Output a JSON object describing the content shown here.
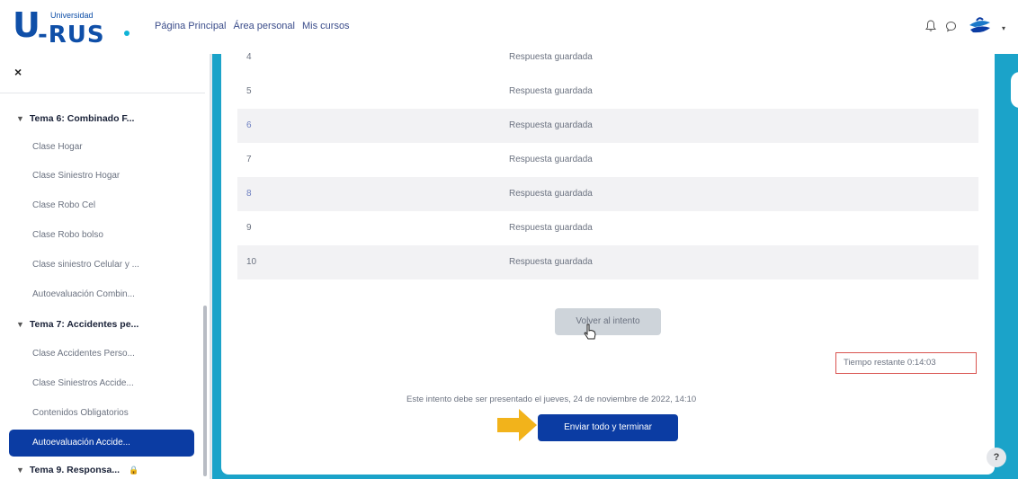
{
  "header": {
    "logo_main": "U",
    "logo_rus": "-RUS",
    "logo_small": "Universidad",
    "nav": [
      "Página Principal",
      "Área personal",
      "Mis cursos"
    ],
    "icons": [
      "bell-icon",
      "chat-icon",
      "avatar"
    ]
  },
  "sidebar": {
    "close": "×",
    "sections": [
      {
        "label": "Tema 6: Combinado F..."
      },
      {
        "label": "Tema 7: Accidentes pe..."
      },
      {
        "label": "Tema 9. Responsa..."
      }
    ],
    "items": [
      "Clase Hogar",
      "Clase Siniestro Hogar",
      "Clase Robo Cel",
      "Clase Robo bolso",
      "Clase siniestro Celular y ...",
      "Autoevaluación Combin...",
      "Clase Accidentes Perso...",
      "Clase Siniestros Accide...",
      "Contenidos Obligatorios",
      "Autoevaluación Accide..."
    ]
  },
  "summary": {
    "rows": [
      {
        "num": "4",
        "status": "Respuesta guardada"
      },
      {
        "num": "5",
        "status": "Respuesta guardada"
      },
      {
        "num": "6",
        "status": "Respuesta guardada"
      },
      {
        "num": "7",
        "status": "Respuesta guardada"
      },
      {
        "num": "8",
        "status": "Respuesta guardada"
      },
      {
        "num": "9",
        "status": "Respuesta guardada"
      },
      {
        "num": "10",
        "status": "Respuesta guardada"
      }
    ],
    "return_button": "Volver al intento",
    "timer": "Tiempo restante 0:14:03",
    "notice": "Este intento debe ser presentado el jueves, 24 de noviembre de 2022, 14:10",
    "submit_button": "Enviar todo y terminar",
    "help": "?"
  },
  "colors": {
    "primary": "#0b3ca3",
    "accent_bg": "#1ba3c9",
    "timer_border": "#d9534f",
    "arrow": "#f2b31b"
  }
}
